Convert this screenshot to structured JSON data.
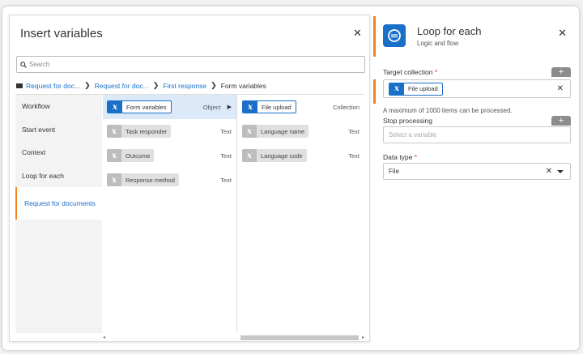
{
  "insert_dialog": {
    "title": "Insert variables",
    "close_glyph": "✕",
    "search_placeholder": "Search",
    "breadcrumb": [
      {
        "label": "Request for doc..."
      },
      {
        "label": "Request for doc..."
      },
      {
        "label": "First response"
      },
      {
        "label": "Form variables"
      }
    ],
    "nav_items": [
      {
        "label": "Workflow"
      },
      {
        "label": "Start event"
      },
      {
        "label": "Context"
      },
      {
        "label": "Loop for each"
      },
      {
        "label": "Request for documents"
      }
    ],
    "variables": [
      {
        "label": "Form variables",
        "type": "Object",
        "selected": true
      },
      {
        "label": "Task responder",
        "type": "Text"
      },
      {
        "label": "Outcome",
        "type": "Text"
      },
      {
        "label": "Response method",
        "type": "Text"
      }
    ],
    "sub_variables": [
      {
        "label": "File upload",
        "type": "Collection"
      },
      {
        "label": "Language name",
        "type": "Text"
      },
      {
        "label": "Language code",
        "type": "Text"
      }
    ],
    "scroll_left": "◂",
    "scroll_right": "▸"
  },
  "panel": {
    "title": "Loop for each",
    "subtitle": "Logic and flow",
    "close_glyph": "✕",
    "target_collection_label": "Target collection",
    "required_mark": "*",
    "target_collection_value": "File upload",
    "hint": "A maximum of 1000 items can be processed.",
    "stop_processing_label": "Stop processing",
    "stop_processing_placeholder": "Select a variable",
    "data_type_label": "Data type",
    "data_type_value": "File",
    "plus_glyph": "+"
  },
  "colors": {
    "accent_blue": "#1a6fc9",
    "accent_orange": "#f5821f",
    "chip_grey": "#bdbdbd"
  }
}
